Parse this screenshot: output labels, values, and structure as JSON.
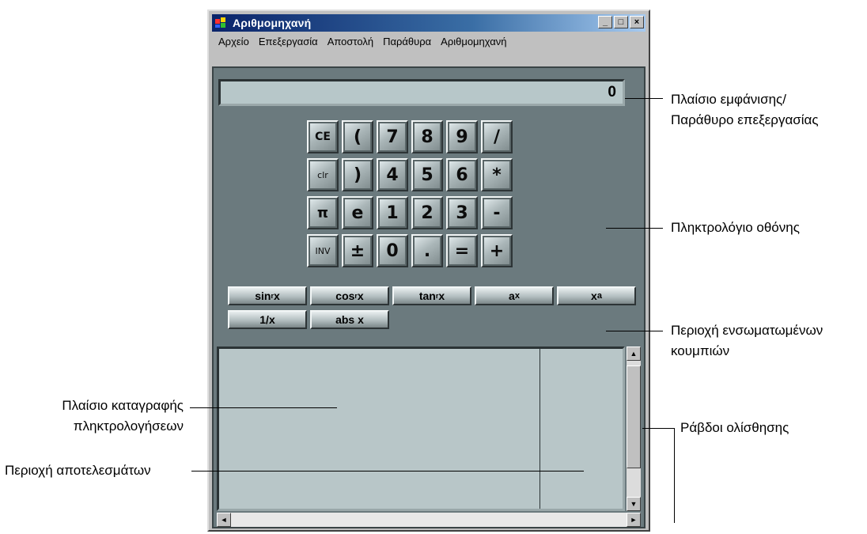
{
  "window": {
    "title": "Αριθμομηχανή",
    "buttons": {
      "minimize": "_",
      "maximize": "□",
      "close": "×"
    }
  },
  "menu": [
    "Αρχείο",
    "Επεξεργασία",
    "Αποστολή",
    "Παράθυρα",
    "Αριθμομηχανή"
  ],
  "display": {
    "value": "0"
  },
  "keypad": {
    "rows": [
      [
        "CE",
        "(",
        "7",
        "8",
        "9",
        "/"
      ],
      [
        "clr",
        ")",
        "4",
        "5",
        "6",
        "*"
      ],
      [
        "π",
        "e",
        "1",
        "2",
        "3",
        "-"
      ],
      [
        "INV",
        "±",
        "0",
        ".",
        "=",
        "+"
      ]
    ]
  },
  "function_keys": [
    "sin",
    "cos",
    "tan",
    "a",
    "x",
    "1/x",
    "abs x"
  ],
  "function_key_parts": {
    "sin": {
      "main": "sin",
      "sub": "r",
      "after": "x"
    },
    "cos": {
      "main": "cos",
      "sub": "r",
      "after": "x"
    },
    "tan": {
      "main": "tan",
      "sub": "r",
      "after": "x"
    },
    "ax": {
      "main": "a",
      "sup": "x"
    },
    "xa": {
      "main": "x",
      "sup": "a"
    },
    "recip": {
      "main": "1/x"
    },
    "abs": {
      "main": "abs x"
    }
  },
  "scroll": {
    "up": "▲",
    "down": "▼",
    "left": "◄",
    "right": "►"
  },
  "annotations": {
    "display_1": "Πλαίσιο εμφάνισης/",
    "display_2": "Παράθυρο επεξεργασίας",
    "keypad": "Πληκτρολόγιο οθόνης",
    "builtin_1": "Περιοχή ενσωματωμένων",
    "builtin_2": "κουμπιών",
    "tape_1": "Πλαίσιο καταγραφής",
    "tape_2": "πληκτρολογήσεων",
    "results": "Περιοχή αποτελεσμάτων",
    "scrollbars": "Ράβδοι ολίσθησης"
  }
}
